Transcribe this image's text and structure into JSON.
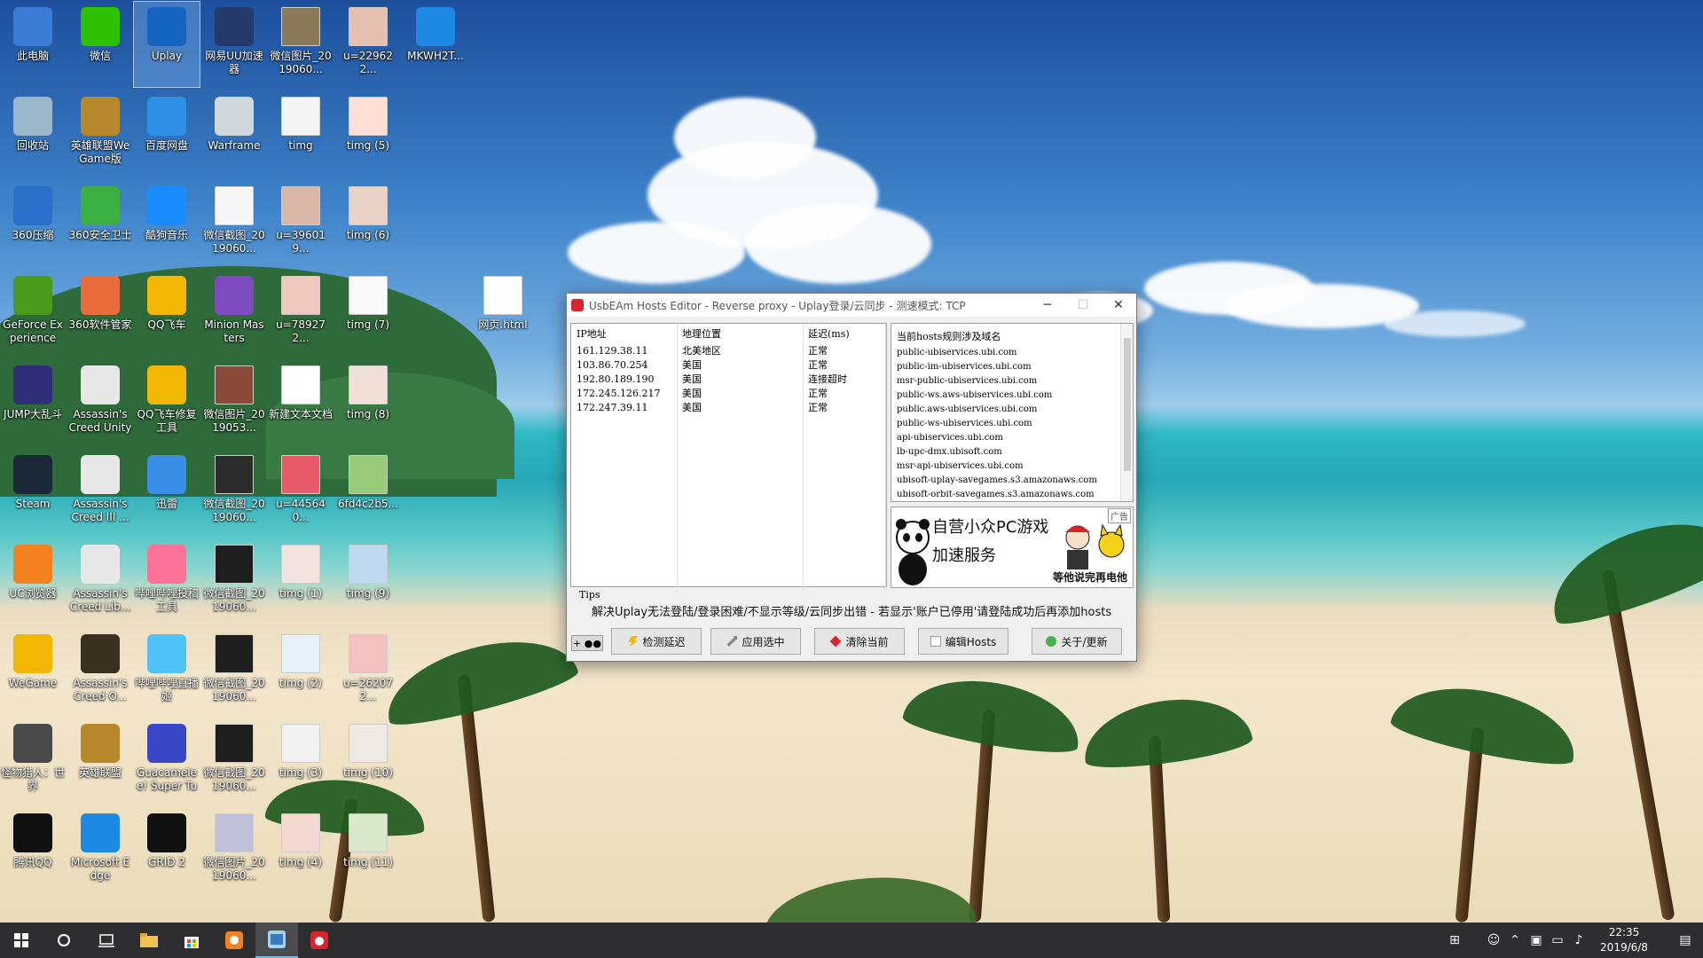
{
  "desktop_icons": [
    {
      "label": "此电脑",
      "icon": "computer-icon",
      "color": "#3a7bd5"
    },
    {
      "label": "微信",
      "icon": "wechat-icon",
      "color": "#2dc100"
    },
    {
      "label": "Uplay",
      "icon": "uplay-icon",
      "color": "#1565c0"
    },
    {
      "label": "网易UU加速器",
      "icon": "uu-accelerator-icon",
      "color": "#243a6b"
    },
    {
      "label": "微信图片_2019060...",
      "icon": "image-file-icon",
      "color": "#8a7a5a"
    },
    {
      "label": "u=229622...",
      "icon": "image-file-icon",
      "color": "#e6c0b0"
    },
    {
      "label": "MKWH2T...",
      "icon": "ie-icon",
      "color": "#1e88e5"
    },
    {
      "label": "回收站",
      "icon": "recycle-bin-icon",
      "color": "#9bb6c9"
    },
    {
      "label": "英雄联盟WeGame版",
      "icon": "lol-icon",
      "color": "#b8892c"
    },
    {
      "label": "百度网盘",
      "icon": "baidu-netdisk-icon",
      "color": "#2e8fe6"
    },
    {
      "label": "Warframe",
      "icon": "warframe-icon",
      "color": "#cfd8dc"
    },
    {
      "label": "timg",
      "icon": "image-file-icon",
      "color": "#f5f5f5"
    },
    {
      "label": "timg (5)",
      "icon": "image-file-icon",
      "color": "#ffe0d8"
    },
    {
      "label": "360压缩",
      "icon": "360zip-icon",
      "color": "#2a6fc9"
    },
    {
      "label": "360安全卫士",
      "icon": "360safe-icon",
      "color": "#3cb043"
    },
    {
      "label": "酷狗音乐",
      "icon": "kugou-icon",
      "color": "#1a8cff"
    },
    {
      "label": "微信截图_2019060...",
      "icon": "image-file-icon",
      "color": "#f7f7f7"
    },
    {
      "label": "u=396019...",
      "icon": "image-file-icon",
      "color": "#d8b6a8"
    },
    {
      "label": "timg (6)",
      "icon": "image-file-icon",
      "color": "#e9d2c8"
    },
    {
      "label": "GeForce Experience",
      "icon": "geforce-icon",
      "color": "#4a9a1e"
    },
    {
      "label": "360软件管家",
      "icon": "360software-icon",
      "color": "#e96a3a"
    },
    {
      "label": "QQ飞车",
      "icon": "qqspeed-icon",
      "color": "#f2b705"
    },
    {
      "label": "Minion Masters",
      "icon": "minion-masters-icon",
      "color": "#7d4bbf"
    },
    {
      "label": "u=789272...",
      "icon": "image-file-icon",
      "color": "#f0c8c0"
    },
    {
      "label": "timg (7)",
      "icon": "image-file-icon",
      "color": "#fafafa"
    },
    {
      "label": "网页.html",
      "icon": "html-file-icon",
      "color": "#ffffff"
    },
    {
      "label": "JUMP大乱斗",
      "icon": "jump-icon",
      "color": "#2d2d7a"
    },
    {
      "label": "Assassin's Creed Unity",
      "icon": "ac-unity-icon",
      "color": "#e8e8e8"
    },
    {
      "label": "QQ飞车修复工具",
      "icon": "qqspeed-repair-icon",
      "color": "#f2b705"
    },
    {
      "label": "微信图片_2019053...",
      "icon": "image-file-icon",
      "color": "#8a4a3a"
    },
    {
      "label": "新建文本文档",
      "icon": "text-file-icon",
      "color": "#ffffff"
    },
    {
      "label": "timg (8)",
      "icon": "image-file-icon",
      "color": "#f0e0d8"
    },
    {
      "label": "Steam",
      "icon": "steam-icon",
      "color": "#1b2838"
    },
    {
      "label": "Assassin's Creed III ...",
      "icon": "ac3-icon",
      "color": "#e8e8e8"
    },
    {
      "label": "迅雷",
      "icon": "xunlei-icon",
      "color": "#3a8ee6"
    },
    {
      "label": "微信截图_2019060...",
      "icon": "image-file-icon",
      "color": "#2b2b2b"
    },
    {
      "label": "u=445640...",
      "icon": "image-file-icon",
      "color": "#e85a6a"
    },
    {
      "label": "6fd4c2b5...",
      "icon": "image-file-icon",
      "color": "#9acb7a"
    },
    {
      "label": "UC浏览器",
      "icon": "uc-browser-icon",
      "color": "#f58220"
    },
    {
      "label": "Assassin's Creed Lib...",
      "icon": "ac-liberation-icon",
      "color": "#e8e8e8"
    },
    {
      "label": "哔哩哔哩投稿工具",
      "icon": "bilibili-upload-icon",
      "color": "#fb7299"
    },
    {
      "label": "微信截图_2019060...",
      "icon": "image-file-icon",
      "color": "#1e1e1e"
    },
    {
      "label": "timg (1)",
      "icon": "image-file-icon",
      "color": "#f3e4e0"
    },
    {
      "label": "timg (9)",
      "icon": "image-file-icon",
      "color": "#c0d8f0"
    },
    {
      "label": "WeGame",
      "icon": "wegame-icon",
      "color": "#f2b705"
    },
    {
      "label": "Assassin's Creed O...",
      "icon": "ac-origins-icon",
      "color": "#3a3020"
    },
    {
      "label": "哔哩哔哩直播姬",
      "icon": "bilibili-live-icon",
      "color": "#4fc3f7"
    },
    {
      "label": "微信截图_2019060...",
      "icon": "image-file-icon",
      "color": "#1e1e1e"
    },
    {
      "label": "timg (2)",
      "icon": "image-file-icon",
      "color": "#e6f2fa"
    },
    {
      "label": "u=262072...",
      "icon": "image-file-icon",
      "color": "#f5c0c0"
    },
    {
      "label": "怪物猎人：世界",
      "icon": "monster-hunter-icon",
      "color": "#4a4a4a"
    },
    {
      "label": "英雄联盟",
      "icon": "lol-icon",
      "color": "#b8892c"
    },
    {
      "label": "Guacamelee! Super Tur...",
      "icon": "guacamelee-icon",
      "color": "#3a48c8"
    },
    {
      "label": "微信截图_2019060...",
      "icon": "image-file-icon",
      "color": "#1e1e1e"
    },
    {
      "label": "timg (3)",
      "icon": "image-file-icon",
      "color": "#f2f2f2"
    },
    {
      "label": "timg (10)",
      "icon": "image-file-icon",
      "color": "#efeae4"
    },
    {
      "label": "腾讯QQ",
      "icon": "qq-icon",
      "color": "#111111"
    },
    {
      "label": "Microsoft Edge",
      "icon": "edge-icon",
      "color": "#1e88e5"
    },
    {
      "label": "GRID 2",
      "icon": "grid2-icon",
      "color": "#111111"
    },
    {
      "label": "微信图片_2019060...",
      "icon": "image-file-icon",
      "color": "#c0c0d8"
    },
    {
      "label": "timg (4)",
      "icon": "image-file-icon",
      "color": "#f2d8d0"
    },
    {
      "label": "timg (11)",
      "icon": "image-file-icon",
      "color": "#d8e8c8"
    }
  ],
  "window": {
    "title": "UsbEAm Hosts Editor - Reverse proxy - Uplay登录/云同步 - 测速模式: TCP",
    "controls": {
      "minimize": "─",
      "maximize": "☐",
      "close": "✕"
    },
    "table": {
      "headers": [
        "IP地址",
        "地理位置",
        "延迟(ms)"
      ],
      "rows": [
        [
          "161.129.38.11",
          "北美地区",
          "正常"
        ],
        [
          "103.86.70.254",
          "美国",
          "正常"
        ],
        [
          "192.80.189.190",
          "美国",
          "连接超时"
        ],
        [
          "172.245.126.217",
          "美国",
          "正常"
        ],
        [
          "172.247.39.11",
          "美国",
          "正常"
        ]
      ]
    },
    "hosts_panel": {
      "title": "当前hosts规则涉及域名",
      "items": [
        "public-ubiservices.ubi.com",
        "public-im-ubiservices.ubi.com",
        "msr-public-ubiservices.ubi.com",
        "public-ws.aws-ubiservices.ubi.com",
        "public.aws-ubiservices.ubi.com",
        "public-ws-ubiservices.ubi.com",
        "api-ubiservices.ubi.com",
        "lb-upc-dmx.ubisoft.com",
        "msr-api-ubiservices.ubi.com",
        "ubisoft-uplay-savegames.s3.amazonaws.com",
        "ubisoft-orbit-savegames.s3.amazonaws.com"
      ]
    },
    "ad": {
      "tag": "广告",
      "line1": "自营小众PC游戏",
      "line2": "加速服务",
      "line3": "等他说完再电他"
    },
    "tips": {
      "label": "Tips",
      "text": "解决Uplay无法登陆/登录困难/不显示等级/云同步出错 - 若显示'账户已停用'请登陆成功后再添加hosts"
    },
    "toggle_label": "+ ●●",
    "buttons": [
      {
        "label": "检测延迟",
        "icon_color": "#f2b705"
      },
      {
        "label": "应用选中",
        "icon_color": "#7a7a7a"
      },
      {
        "label": "清除当前",
        "icon_color": "#d8242c"
      },
      {
        "label": "编辑Hosts",
        "icon_color": "#9a9a9a"
      },
      {
        "label": "关于/更新",
        "icon_color": "#4caf50"
      }
    ]
  },
  "taskbar": {
    "clock_time": "22:35",
    "clock_date": "2019/6/8",
    "accent": "#76b9ed"
  }
}
